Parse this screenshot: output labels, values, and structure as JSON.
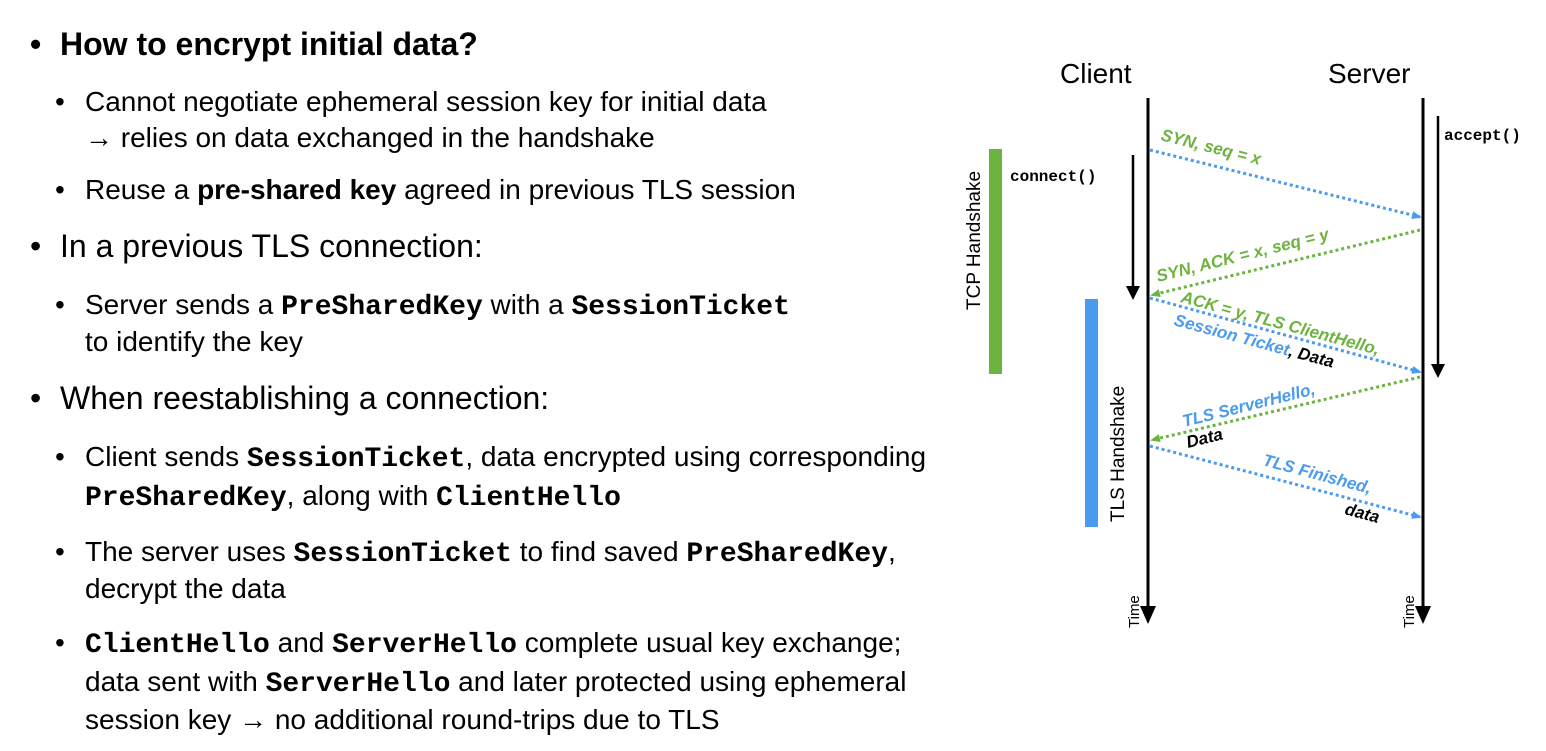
{
  "bullets": {
    "b1": {
      "text": "How to encrypt initial data?"
    },
    "b1a": {
      "line1": "Cannot negotiate ephemeral session key for initial data",
      "line2": "→ relies on data exchanged in the handshake"
    },
    "b1b": {
      "pre": "Reuse a ",
      "bold": "pre-shared key",
      "post": " agreed in previous TLS session"
    },
    "b2": {
      "text": "In a previous TLS connection:"
    },
    "b2a": {
      "pre": "Server sends a ",
      "code1": "PreSharedKey",
      "mid": " with a ",
      "code2": "SessionTicket",
      "line2": "to identify the key"
    },
    "b3": {
      "text": "When reestablishing a connection:"
    },
    "b3a": {
      "pre": "Client sends ",
      "code1": "SessionTicket",
      "mid": ", data encrypted using corresponding",
      "code2": "PreSharedKey",
      "mid2": ", along with ",
      "code3": "ClientHello"
    },
    "b3b": {
      "pre": "The server uses ",
      "code1": "SessionTicket",
      "mid": " to find saved ",
      "code2": "PreSharedKey",
      "post": ",",
      "line2": "decrypt the data"
    },
    "b3c": {
      "code1": "ClientHello",
      "mid": " and ",
      "code2": "ServerHello",
      "post": " complete usual key exchange;",
      "line2pre": "data sent with ",
      "line2code": "ServerHello",
      "line2post": " and later protected using ephemeral",
      "line3": "session key → no additional round-trips due to TLS"
    }
  },
  "diagram": {
    "client_label": "Client",
    "server_label": "Server",
    "connect_call": "connect()",
    "accept_call": "accept()",
    "tcp_handshake_label": "TCP Handshake",
    "tls_handshake_label": "TLS Handshake",
    "time_label_left": "Time",
    "time_label_right": "Time",
    "msg_syn": "SYN, seq = x",
    "msg_synack": "SYN, ACK = x, seq = y",
    "msg_ack": "ACK = y, TLS ClientHello,",
    "msg_ack_ticket": "Session Ticket",
    "msg_ack_data": ", Data",
    "msg_serverhello": "TLS ServerHello,",
    "msg_serverhello_data": "Data",
    "msg_finished": "TLS Finished,",
    "msg_finished_data": "data",
    "colors": {
      "tcp": "#6db33f",
      "tls": "#4a9bef",
      "black": "#000000"
    }
  }
}
